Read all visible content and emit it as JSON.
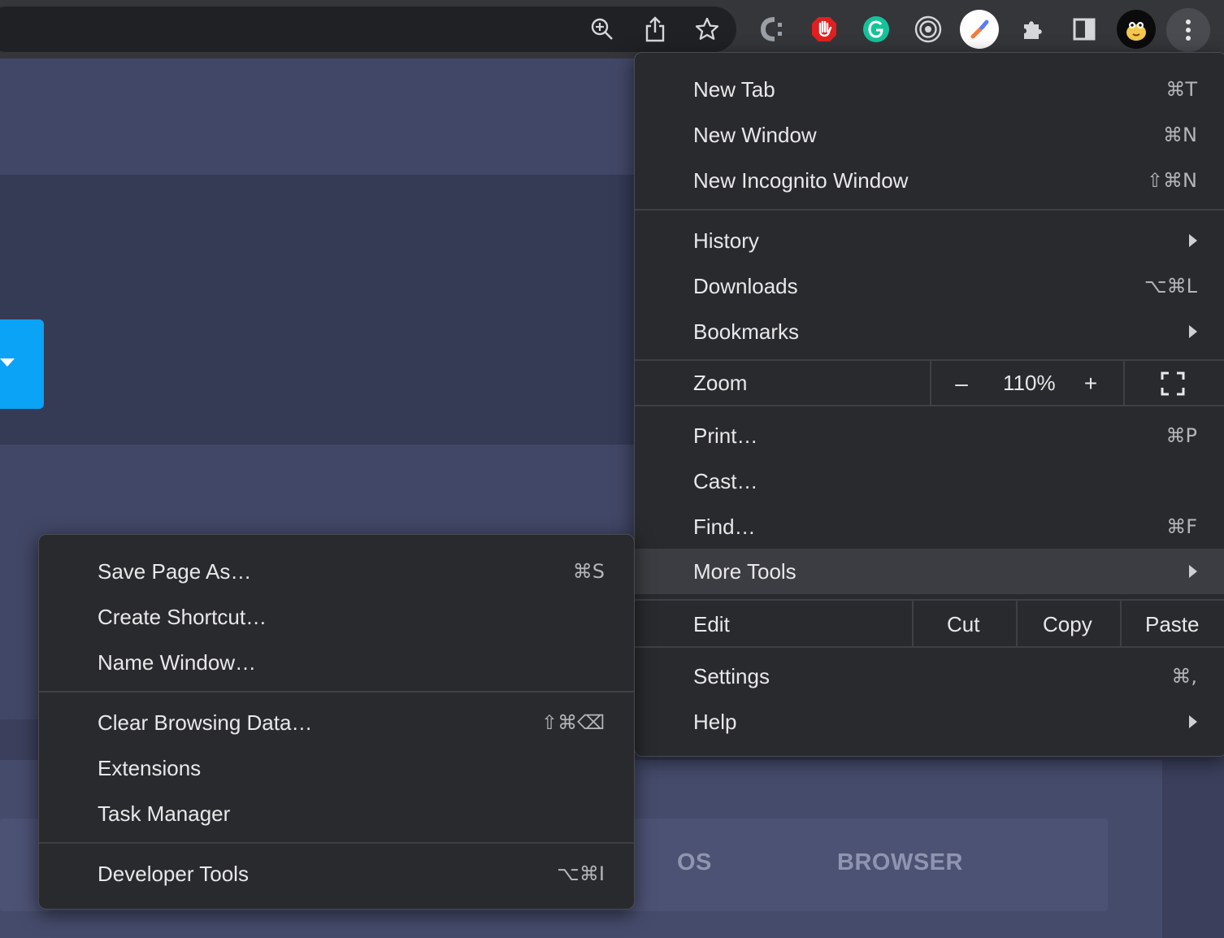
{
  "toolbar": {
    "icons": [
      "zoom-in-icon",
      "share-icon",
      "bookmark-star-icon",
      "copyleaks-extension-icon",
      "adblock-extension-icon",
      "grammarly-extension-icon",
      "target-extension-icon",
      "color-picker-extension-icon",
      "extensions-puzzle-icon",
      "side-panel-icon",
      "profile-avatar-icon",
      "kebab-menu-icon"
    ]
  },
  "page": {
    "tabs": [
      "OS",
      "BROWSER"
    ]
  },
  "main_menu": {
    "items": [
      {
        "label": "New Tab",
        "shortcut": "⌘T"
      },
      {
        "label": "New Window",
        "shortcut": "⌘N"
      },
      {
        "label": "New Incognito Window",
        "shortcut": "⇧⌘N"
      },
      {
        "label": "History",
        "submenu": true
      },
      {
        "label": "Downloads",
        "shortcut": "⌥⌘L"
      },
      {
        "label": "Bookmarks",
        "submenu": true
      },
      {
        "label": "Print…",
        "shortcut": "⌘P"
      },
      {
        "label": "Cast…"
      },
      {
        "label": "Find…",
        "shortcut": "⌘F"
      },
      {
        "label": "More Tools",
        "submenu": true,
        "highlighted": true
      },
      {
        "label": "Settings",
        "shortcut": "⌘,"
      },
      {
        "label": "Help",
        "submenu": true
      }
    ],
    "zoom": {
      "label": "Zoom",
      "minus": "–",
      "value": "110%",
      "plus": "+"
    },
    "edit": {
      "label": "Edit",
      "cut": "Cut",
      "copy": "Copy",
      "paste": "Paste"
    }
  },
  "more_tools_menu": {
    "items": [
      {
        "label": "Save Page As…",
        "shortcut": "⌘S"
      },
      {
        "label": "Create Shortcut…"
      },
      {
        "label": "Name Window…"
      },
      {
        "label": "Clear Browsing Data…",
        "shortcut": "⇧⌘⌫"
      },
      {
        "label": "Extensions"
      },
      {
        "label": "Task Manager"
      },
      {
        "label": "Developer Tools",
        "shortcut": "⌥⌘I"
      }
    ]
  },
  "colors": {
    "accent_blue": "#0aa3f5",
    "menu_bg": "#292a2d",
    "highlight": "#3c3d42"
  }
}
